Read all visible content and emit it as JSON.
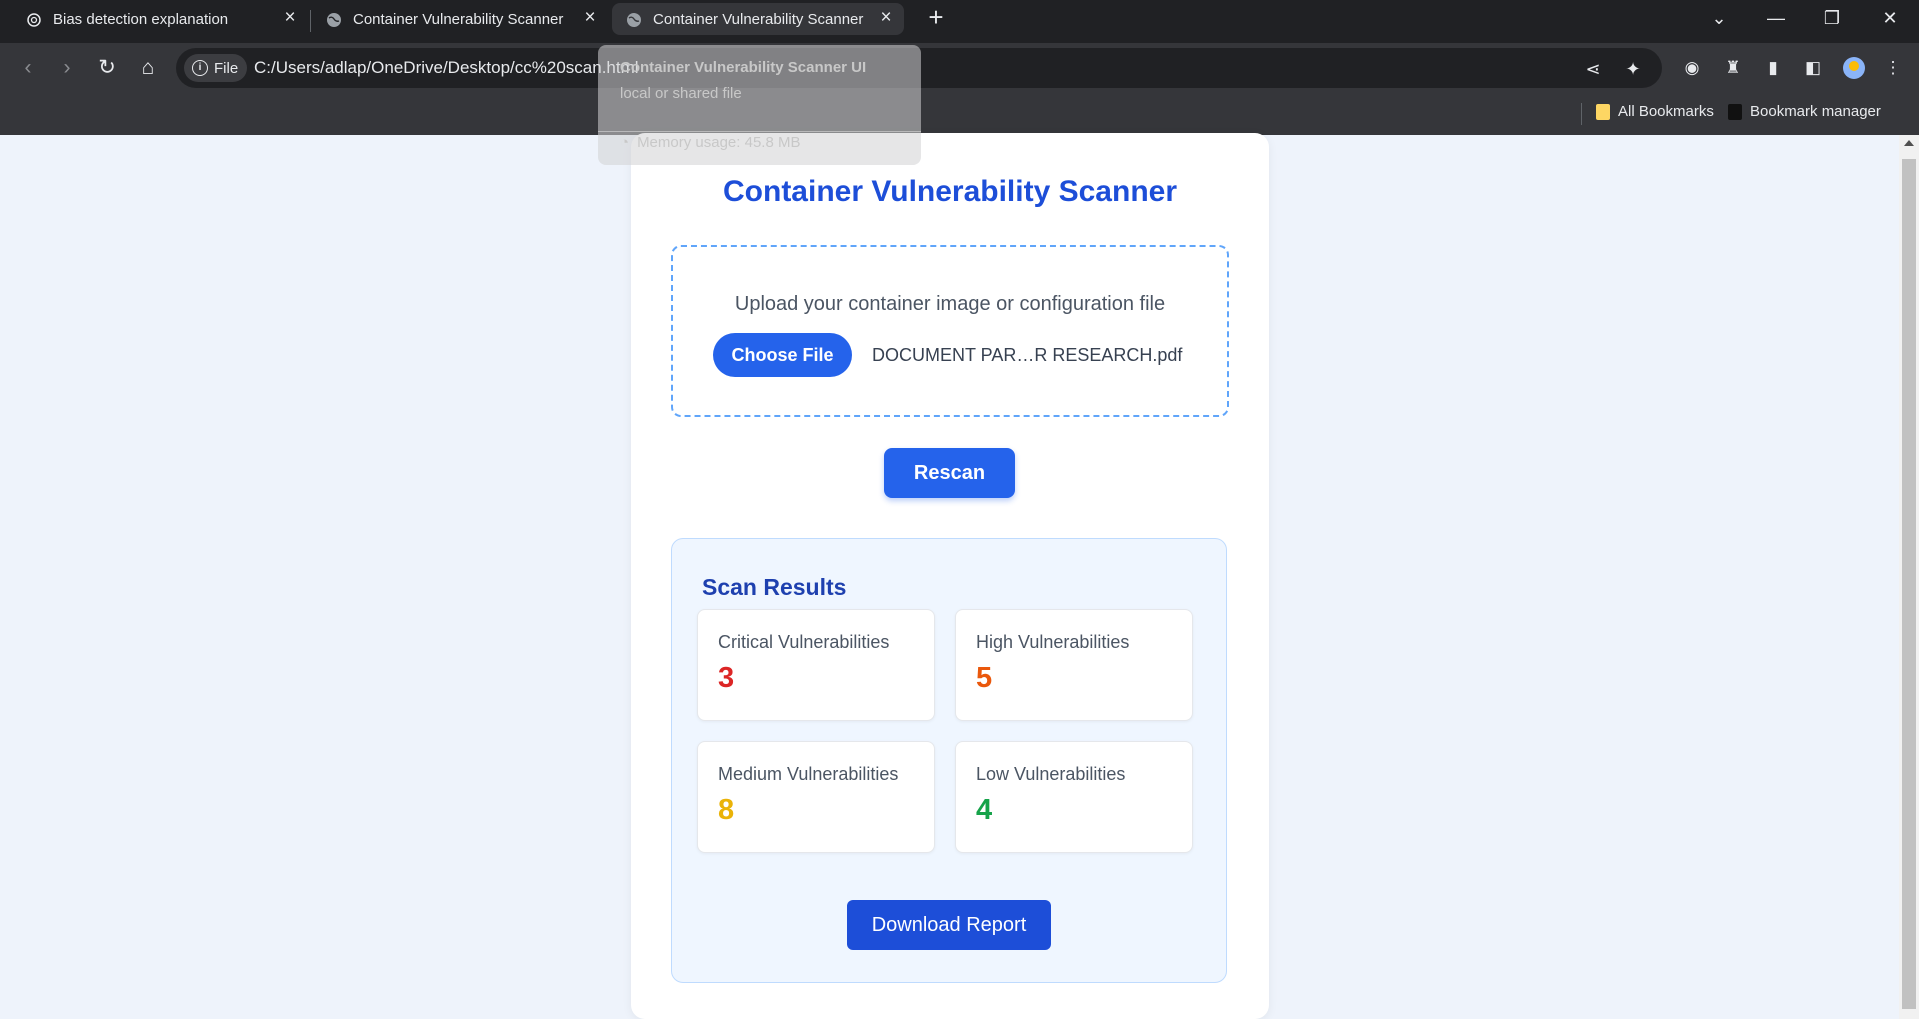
{
  "browser": {
    "tabs": [
      {
        "title": "Bias detection explanation",
        "icon": "openai-icon"
      },
      {
        "title": "Container Vulnerability Scanner UI",
        "icon": "globe-icon"
      },
      {
        "title": "Container Vulnerability Scanner UI",
        "icon": "globe-icon",
        "active": true
      }
    ],
    "new_tab_label": "+",
    "file_chip_label": "File",
    "url": "C:/Users/adlap/OneDrive/Desktop/cc%20scan.html",
    "bookmarks": {
      "all_bookmarks": "All Bookmarks",
      "bookmark_manager": "Bookmark manager"
    },
    "hovercard": {
      "title": "Container Vulnerability Scanner UI",
      "subtitle": "local or shared file",
      "memory": "Memory usage: 45.8 MB"
    }
  },
  "app": {
    "title": "Container Vulnerability Scanner",
    "upload_prompt": "Upload your container image or configuration file",
    "choose_file_label": "Choose File",
    "selected_file": "DOCUMENT PAR…R RESEARCH.pdf",
    "rescan_label": "Rescan",
    "results_title": "Scan Results",
    "results": [
      {
        "label": "Critical Vulnerabilities",
        "value": "3",
        "color": "#dc2626"
      },
      {
        "label": "High Vulnerabilities",
        "value": "5",
        "color": "#ea580c"
      },
      {
        "label": "Medium Vulnerabilities",
        "value": "8",
        "color": "#eab308"
      },
      {
        "label": "Low Vulnerabilities",
        "value": "4",
        "color": "#16a34a"
      }
    ],
    "download_label": "Download Report"
  },
  "colors": {
    "accent": "#2563eb",
    "title": "#1d4ed8",
    "page_bg": "#eef3fb"
  }
}
